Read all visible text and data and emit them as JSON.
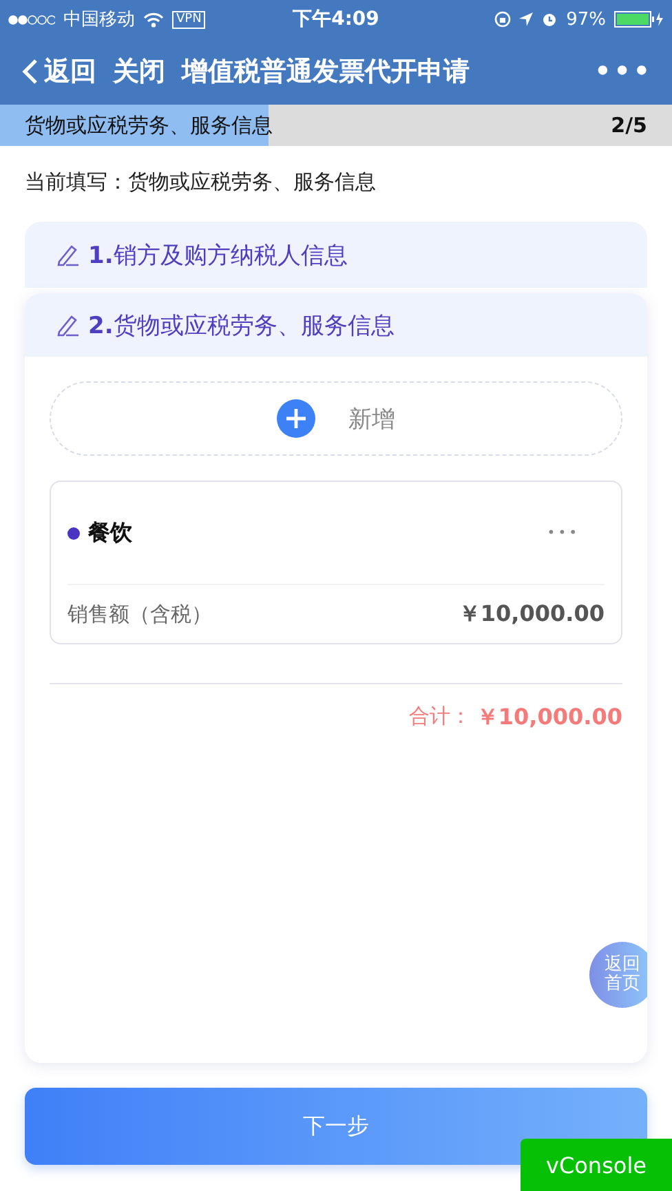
{
  "status_bar": {
    "carrier": "中国移动",
    "vpn": "VPN",
    "time": "下午4:09",
    "battery": "97%"
  },
  "nav": {
    "back": "返回",
    "close": "关闭",
    "title": "增值税普通发票代开申请",
    "more": "•••"
  },
  "progress": {
    "label": "货物或应税劳务、服务信息",
    "step": "2/5",
    "level": 0.4
  },
  "current": "当前填写：货物或应税劳务、服务信息",
  "sections": [
    {
      "number": "1.",
      "title": "销方及购方纳税人信息",
      "expanded": false
    },
    {
      "number": "2.",
      "title": "货物或应税劳务、服务信息",
      "expanded": true
    }
  ],
  "add_button": {
    "label": "新增"
  },
  "items": [
    {
      "name": "餐饮",
      "more": "•••",
      "field_label": "销售额（含税）",
      "amount": "￥10,000.00"
    }
  ],
  "total": {
    "label": "合计：",
    "amount": "￥10,000.00"
  },
  "home_button": "返回首页",
  "next_button": "下一步",
  "vconsole": "vConsole"
}
